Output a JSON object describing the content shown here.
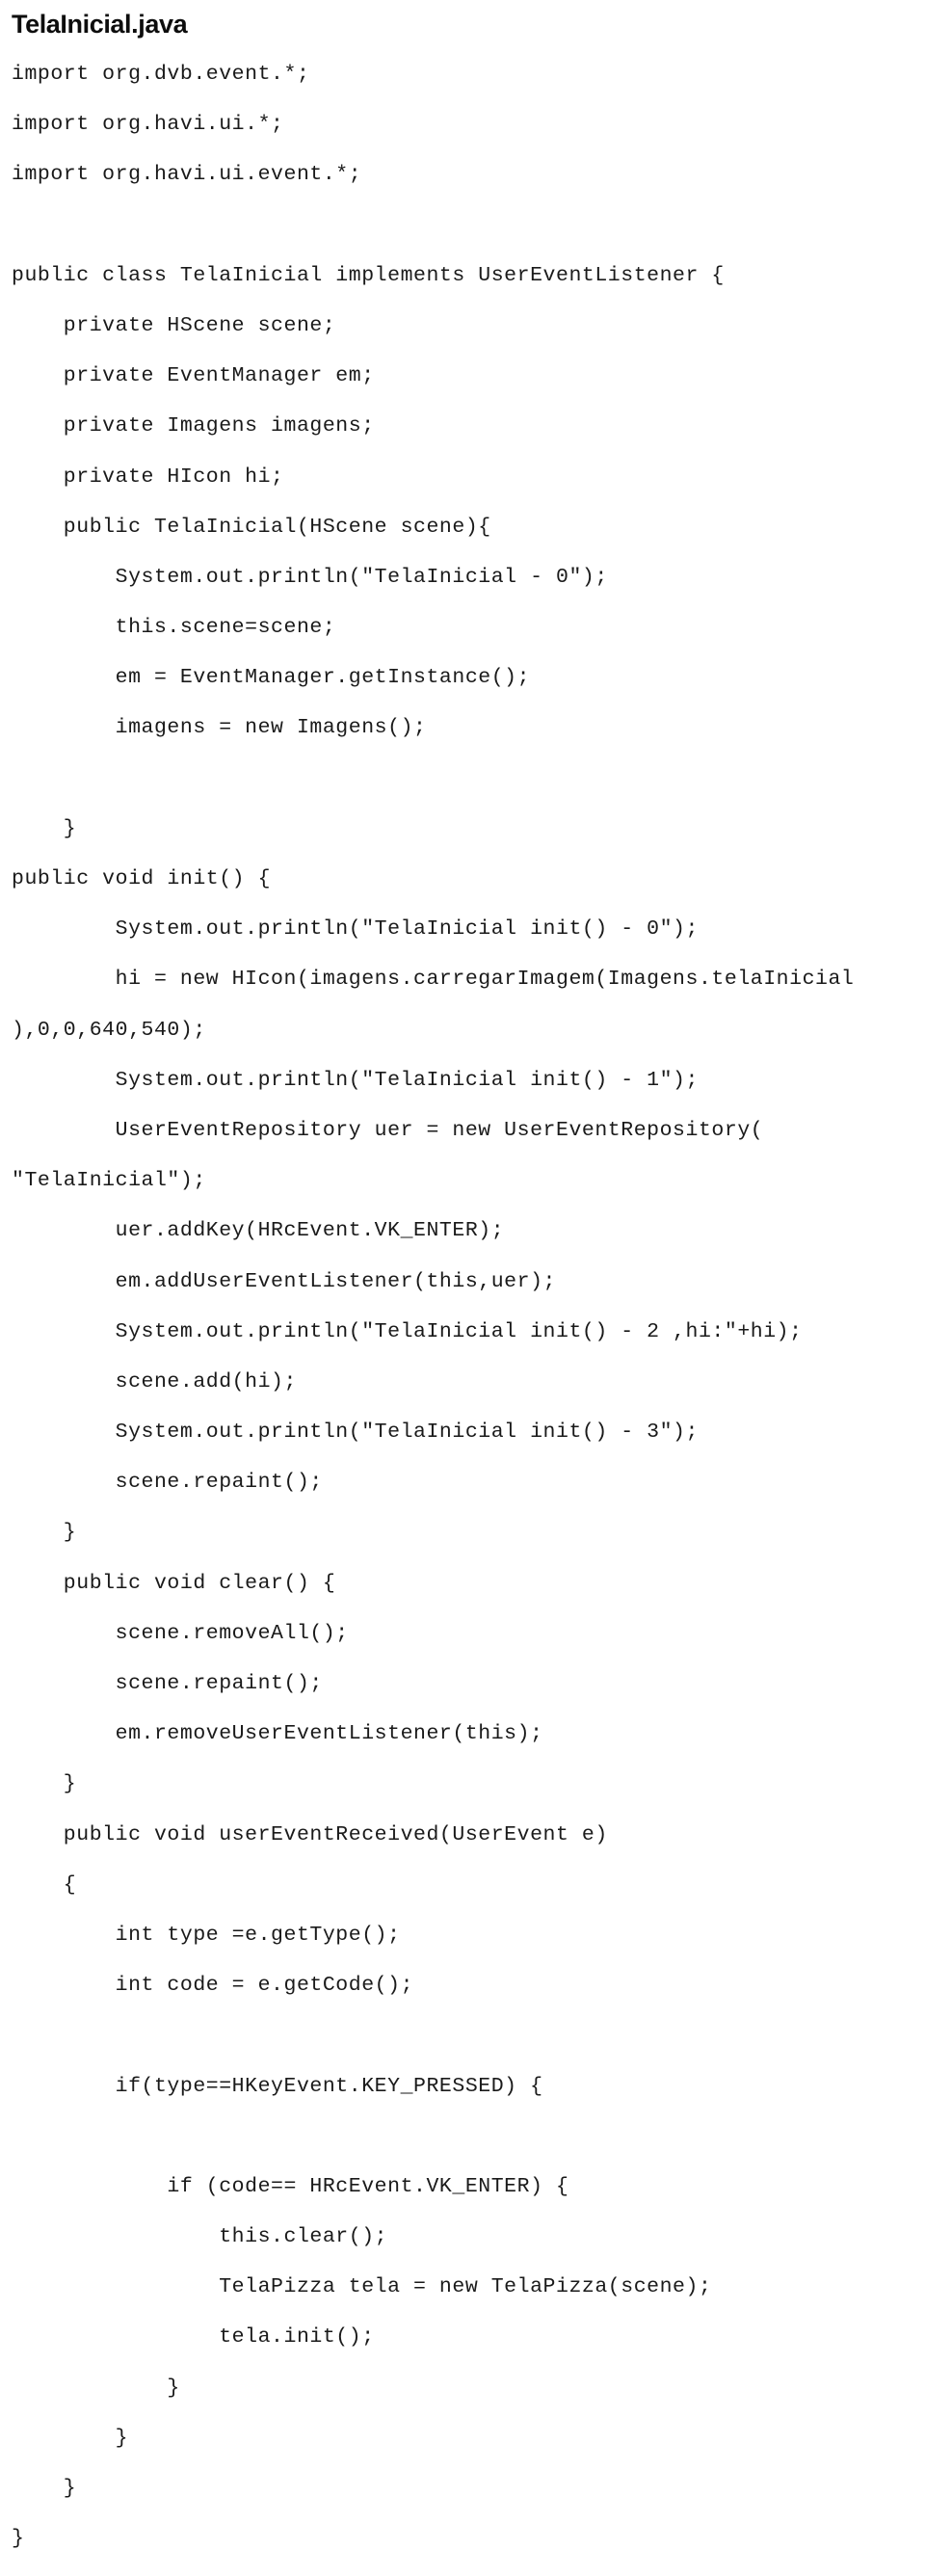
{
  "document": {
    "title": "TelaInicial.java",
    "language": "java",
    "text_color": "#1a1a1a",
    "background_color": "#ffffff"
  },
  "code": {
    "lines": [
      "import org.dvb.event.*;",
      "import org.havi.ui.*;",
      "import org.havi.ui.event.*;",
      "",
      "public class TelaInicial implements UserEventListener {",
      "    private HScene scene;",
      "    private EventManager em;",
      "    private Imagens imagens;",
      "    private HIcon hi;",
      "    public TelaInicial(HScene scene){",
      "        System.out.println(\"TelaInicial - 0\");",
      "        this.scene=scene;",
      "        em = EventManager.getInstance();",
      "        imagens = new Imagens();",
      "",
      "    }",
      "public void init() {",
      "        System.out.println(\"TelaInicial init() - 0\");",
      "        hi = new HIcon(imagens.carregarImagem(Imagens.telaInicial",
      "),0,0,640,540);",
      "        System.out.println(\"TelaInicial init() - 1\");",
      "        UserEventRepository uer = new UserEventRepository(",
      "\"TelaInicial\");",
      "        uer.addKey(HRcEvent.VK_ENTER);",
      "        em.addUserEventListener(this,uer);",
      "        System.out.println(\"TelaInicial init() - 2 ,hi:\"+hi);",
      "        scene.add(hi);",
      "        System.out.println(\"TelaInicial init() - 3\");",
      "        scene.repaint();",
      "    }",
      "    public void clear() {",
      "        scene.removeAll();",
      "        scene.repaint();",
      "        em.removeUserEventListener(this);",
      "    }",
      "    public void userEventReceived(UserEvent e)",
      "    {",
      "        int type =e.getType();",
      "        int code = e.getCode();",
      "",
      "        if(type==HKeyEvent.KEY_PRESSED) {",
      "",
      "            if (code== HRcEvent.VK_ENTER) {",
      "                this.clear();",
      "                TelaPizza tela = new TelaPizza(scene);",
      "                tela.init();",
      "            }",
      "        }",
      "    }",
      "}"
    ]
  }
}
